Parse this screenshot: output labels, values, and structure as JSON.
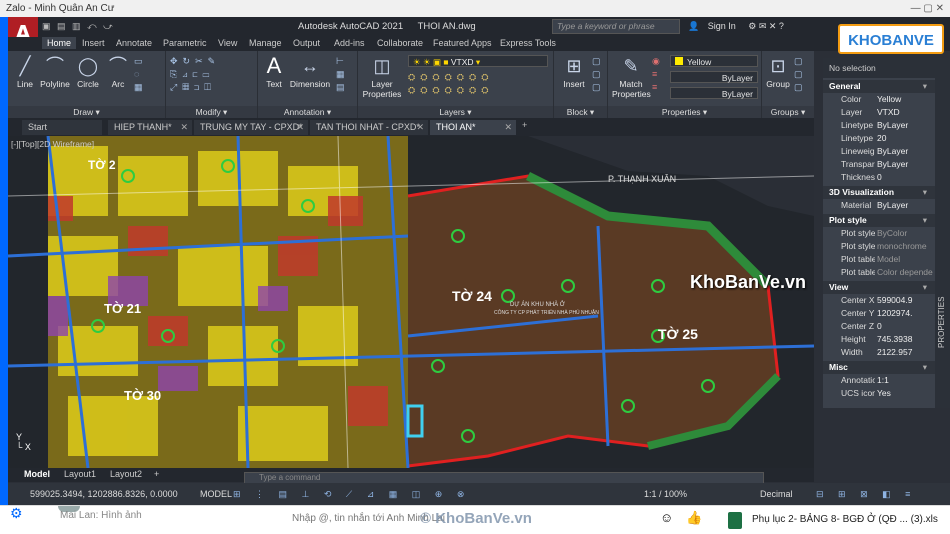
{
  "window": {
    "title": "Zalo - Minh Quân An Cư",
    "controls": "—   ▢   ✕"
  },
  "autocad": {
    "logo": "A",
    "qat": "▣ ▤ ▥ ⤺ ⤻",
    "app_name": "Autodesk AutoCAD 2021",
    "file_name": "THOI AN.dwg",
    "search_placeholder": "Type a keyword or phrase",
    "sign_in": "Sign In",
    "top_icons": "⚙ ✉ ✕ ?"
  },
  "ribbon_tabs": [
    "Home",
    "Insert",
    "Annotate",
    "Parametric",
    "View",
    "Manage",
    "Output",
    "Add-ins",
    "Collaborate",
    "Featured Apps",
    "Express Tools"
  ],
  "ribbon": {
    "draw": {
      "title": "Draw ▾",
      "tools": [
        "Line",
        "Polyline",
        "Circle",
        "Arc"
      ]
    },
    "modify": {
      "title": "Modify ▾"
    },
    "annotation": {
      "title": "Annotation ▾",
      "tools": [
        "Text",
        "Dimension"
      ]
    },
    "layers": {
      "title": "Layers ▾",
      "tool": "Layer Properties",
      "current_layer": "VTXD"
    },
    "block": {
      "title": "Block ▾",
      "tool": "Insert"
    },
    "properties": {
      "title": "Properties ▾",
      "tool": "Match Properties",
      "color": "Yellow",
      "linetype": "ByLayer",
      "lineweight": "ByLayer"
    },
    "groups": {
      "title": "Groups ▾",
      "tool": "Group"
    }
  },
  "doc_tabs": [
    "Start",
    "HIEP THANH*",
    "TRUNG MY TAY - CPXD*",
    "TAN THOI NHAT - CPXD*",
    "THOI AN*"
  ],
  "view_label": "[-][Top][2D Wireframe]",
  "drawing_labels": {
    "to24": "TỜ 24",
    "to25": "TỜ 25",
    "to21": "TỜ 21",
    "to30": "TỜ 30",
    "to2": "TỜ 2",
    "road": "P. THẠNH XUÂN",
    "note1": "DỰ ÁN KHU NHÀ Ở",
    "note2": "CÔNG TY CP PHÁT TRIỂN NHÀ PHÚ NHUẬN"
  },
  "layout_tabs": [
    "Model",
    "Layout1",
    "Layout2"
  ],
  "command_placeholder": "Type a command",
  "status": {
    "coords": "599025.3494, 1202886.8326, 0.0000",
    "space": "MODEL",
    "icons": "⊞ ⋮ ▤ ⊥ ⟲ ⟋ ⊿ ▦ ◫ ⊕ ⊗",
    "zoom": "1:1 / 100%",
    "units": "Decimal",
    "right_icons": "⊟ ⊞ ⊠ ◧ ≡"
  },
  "properties_panel": {
    "selection": "No selection",
    "sections": [
      {
        "name": "General",
        "rows": [
          {
            "k": "Color",
            "v": "Yellow"
          },
          {
            "k": "Layer",
            "v": "VTXD"
          },
          {
            "k": "Linetype",
            "v": "ByLayer"
          },
          {
            "k": "Linetype scale",
            "v": "20"
          },
          {
            "k": "Lineweight",
            "v": "ByLayer"
          },
          {
            "k": "Transparency",
            "v": "ByLayer"
          },
          {
            "k": "Thickness",
            "v": "0"
          }
        ]
      },
      {
        "name": "3D Visualization",
        "rows": [
          {
            "k": "Material",
            "v": "ByLayer"
          }
        ]
      },
      {
        "name": "Plot style",
        "rows": [
          {
            "k": "Plot style",
            "v": "ByColor"
          },
          {
            "k": "Plot style table",
            "v": "monochrome"
          },
          {
            "k": "Plot table attached",
            "v": "Model"
          },
          {
            "k": "Plot table type",
            "v": "Color dependent"
          }
        ]
      },
      {
        "name": "View",
        "rows": [
          {
            "k": "Center X",
            "v": "599004.9"
          },
          {
            "k": "Center Y",
            "v": "1202974."
          },
          {
            "k": "Center Z",
            "v": "0"
          },
          {
            "k": "Height",
            "v": "745.3938"
          },
          {
            "k": "Width",
            "v": "2122.957"
          }
        ]
      },
      {
        "name": "Misc",
        "rows": [
          {
            "k": "Annotation scale",
            "v": "1:1"
          },
          {
            "k": "UCS icon On",
            "v": "Yes"
          }
        ]
      }
    ],
    "side_label": "PROPERTIES"
  },
  "watermark": "KhoBanVe.vn",
  "brand_logo": "KHOBANVE",
  "zalo": {
    "contact_name": "Mai Lan: Hình ảnh",
    "input_placeholder": "Nhập @, tin nhắn tới Anh Minh Lai",
    "watermark": "© KhoBanVe.vn",
    "emoji": "☺",
    "like": "👍",
    "file_name": "Phụ lục 2- BẢNG 8- BGĐ Ở (QĐ ... (3).xls"
  },
  "colors": {
    "accent": "#0068ff",
    "acad_red": "#b01e24",
    "panel": "#3b414b"
  }
}
